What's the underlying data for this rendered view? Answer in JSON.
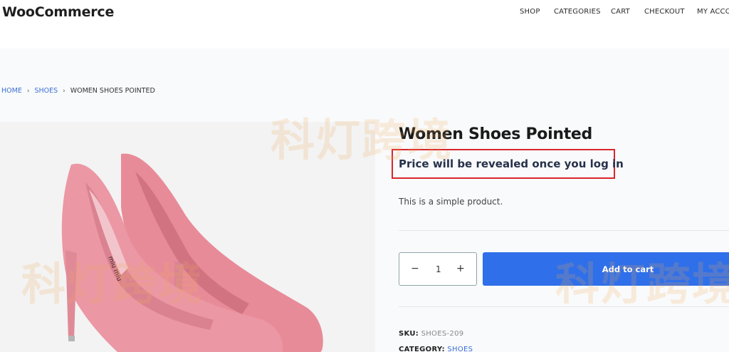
{
  "site": {
    "logo": "WooCommerce"
  },
  "nav": {
    "items": [
      "SHOP",
      "CATEGORIES",
      "CART",
      "CHECKOUT",
      "MY ACCO"
    ]
  },
  "breadcrumb": {
    "home": "HOME",
    "category": "SHOES",
    "current": "WOMEN SHOES POINTED",
    "separator": "›"
  },
  "product": {
    "title": "Women Shoes Pointed",
    "price_notice": "Price will be revealed once you log in",
    "description": "This is a simple product.",
    "quantity": "1",
    "minus_symbol": "−",
    "plus_symbol": "+",
    "add_to_cart_label": "Add to cart",
    "sku_label": "SKU:",
    "sku_value": "SHOES-209",
    "category_label": "CATEGORY:",
    "category_value": "SHOES",
    "image_label": "miu miu"
  },
  "watermark": {
    "text": "科灯跨境"
  },
  "colors": {
    "accent": "#2f6fe9",
    "highlight_border": "#d9262c",
    "link": "#3b6fd4",
    "shoe": "#ec97a4"
  }
}
